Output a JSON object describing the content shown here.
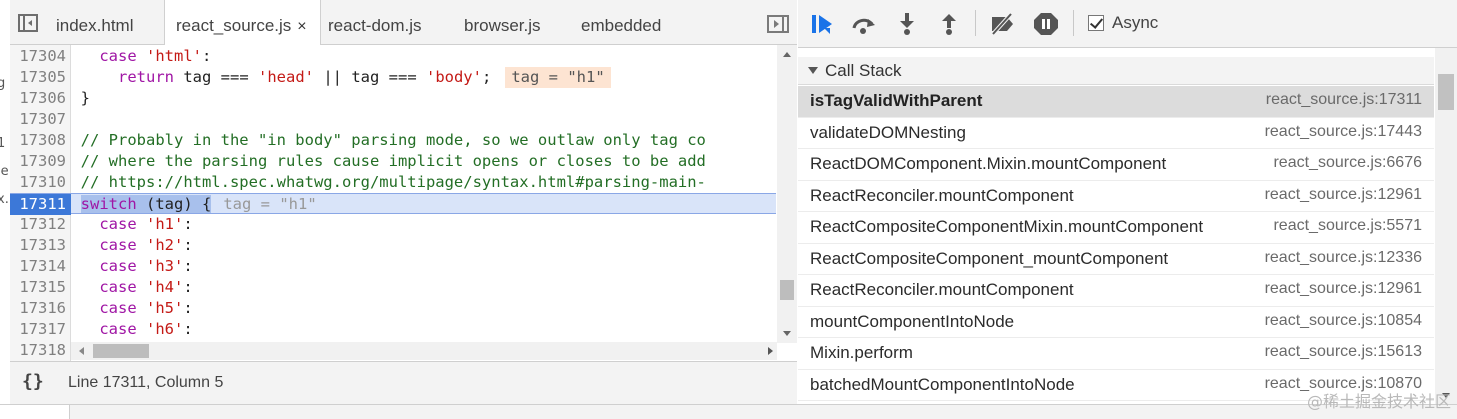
{
  "left_sliver": [
    "g",
    "1",
    "le",
    "x."
  ],
  "tabs": [
    {
      "label": "index.html",
      "active": false
    },
    {
      "label": "react_source.js",
      "active": true
    },
    {
      "label": "react-dom.js",
      "active": false
    },
    {
      "label": "browser.js",
      "active": false
    },
    {
      "label": "embedded",
      "active": false
    }
  ],
  "active_tab_close": "×",
  "code_lines": [
    {
      "num": "17304",
      "code": [
        {
          "t": "    "
        },
        {
          "t": "case",
          "c": "kw"
        },
        {
          "t": " "
        },
        {
          "t": "'html'",
          "c": "str"
        },
        {
          "t": ":"
        }
      ]
    },
    {
      "num": "17305",
      "code": [
        {
          "t": "      "
        },
        {
          "t": "return",
          "c": "kw"
        },
        {
          "t": " tag === "
        },
        {
          "t": "'head'",
          "c": "str"
        },
        {
          "t": " || tag === "
        },
        {
          "t": "'body'",
          "c": "str"
        },
        {
          "t": ";"
        }
      ],
      "inline": "tag = \"h1\""
    },
    {
      "num": "17306",
      "code": [
        {
          "t": "  }"
        }
      ]
    },
    {
      "num": "17307",
      "code": []
    },
    {
      "num": "17308",
      "code": [
        {
          "t": "  // Probably in the \"in body\" parsing mode, so we outlaw only tag co",
          "c": "cmt"
        }
      ]
    },
    {
      "num": "17309",
      "code": [
        {
          "t": "  // where the parsing rules cause implicit opens or closes to be add",
          "c": "cmt"
        }
      ]
    },
    {
      "num": "17310",
      "code": [
        {
          "t": "  // https://html.spec.whatwg.org/multipage/syntax.html#parsing-main-",
          "c": "cmt"
        }
      ]
    },
    {
      "num": "17311",
      "code": [
        {
          "t": "  "
        },
        {
          "t": "switch",
          "c": "kw sel"
        },
        {
          "t": " (tag) {",
          "c": "sel"
        }
      ],
      "inline_faded": "tag = \"h1\"",
      "current": true
    },
    {
      "num": "17312",
      "code": [
        {
          "t": "    "
        },
        {
          "t": "case",
          "c": "kw"
        },
        {
          "t": " "
        },
        {
          "t": "'h1'",
          "c": "str"
        },
        {
          "t": ":"
        }
      ]
    },
    {
      "num": "17313",
      "code": [
        {
          "t": "    "
        },
        {
          "t": "case",
          "c": "kw"
        },
        {
          "t": " "
        },
        {
          "t": "'h2'",
          "c": "str"
        },
        {
          "t": ":"
        }
      ]
    },
    {
      "num": "17314",
      "code": [
        {
          "t": "    "
        },
        {
          "t": "case",
          "c": "kw"
        },
        {
          "t": " "
        },
        {
          "t": "'h3'",
          "c": "str"
        },
        {
          "t": ":"
        }
      ]
    },
    {
      "num": "17315",
      "code": [
        {
          "t": "    "
        },
        {
          "t": "case",
          "c": "kw"
        },
        {
          "t": " "
        },
        {
          "t": "'h4'",
          "c": "str"
        },
        {
          "t": ":"
        }
      ]
    },
    {
      "num": "17316",
      "code": [
        {
          "t": "    "
        },
        {
          "t": "case",
          "c": "kw"
        },
        {
          "t": " "
        },
        {
          "t": "'h5'",
          "c": "str"
        },
        {
          "t": ":"
        }
      ]
    },
    {
      "num": "17317",
      "code": [
        {
          "t": "    "
        },
        {
          "t": "case",
          "c": "kw"
        },
        {
          "t": " "
        },
        {
          "t": "'h6'",
          "c": "str"
        },
        {
          "t": ":"
        }
      ]
    },
    {
      "num": "17318",
      "code": []
    }
  ],
  "status": {
    "pretty_print": "{}",
    "cursor_position": "Line 17311, Column 5"
  },
  "debugger": {
    "async_label": "Async",
    "async_checked": true,
    "call_stack_title": "Call Stack",
    "frames": [
      {
        "name": "isTagValidWithParent",
        "location": "react_source.js:17311",
        "selected": true
      },
      {
        "name": "validateDOMNesting",
        "location": "react_source.js:17443"
      },
      {
        "name": "ReactDOMComponent.Mixin.mountComponent",
        "location": "react_source.js:6676"
      },
      {
        "name": "ReactReconciler.mountComponent",
        "location": "react_source.js:12961"
      },
      {
        "name": "ReactCompositeComponentMixin.mountComponent",
        "location": "react_source.js:5571"
      },
      {
        "name": "ReactCompositeComponent_mountComponent",
        "location": "react_source.js:12336"
      },
      {
        "name": "ReactReconciler.mountComponent",
        "location": "react_source.js:12961"
      },
      {
        "name": "mountComponentIntoNode",
        "location": "react_source.js:10854"
      },
      {
        "name": "Mixin.perform",
        "location": "react_source.js:15613"
      },
      {
        "name": "batchedMountComponentIntoNode",
        "location": "react_source.js:10870"
      }
    ]
  },
  "watermark": "@稀土掘金技术社区",
  "colors": {
    "accent_blue": "#1a73e8",
    "current_line": "#d9e4f9",
    "keyword": "#a016a5",
    "string": "#c41a16",
    "comment": "#236e25"
  },
  "icons": [
    "panel-toggle-icon",
    "resume-icon",
    "step-over-icon",
    "step-into-icon",
    "step-out-icon",
    "deactivate-breakpoints-icon",
    "pause-on-exceptions-icon",
    "checkbox-icon",
    "expand-triangle-icon"
  ]
}
